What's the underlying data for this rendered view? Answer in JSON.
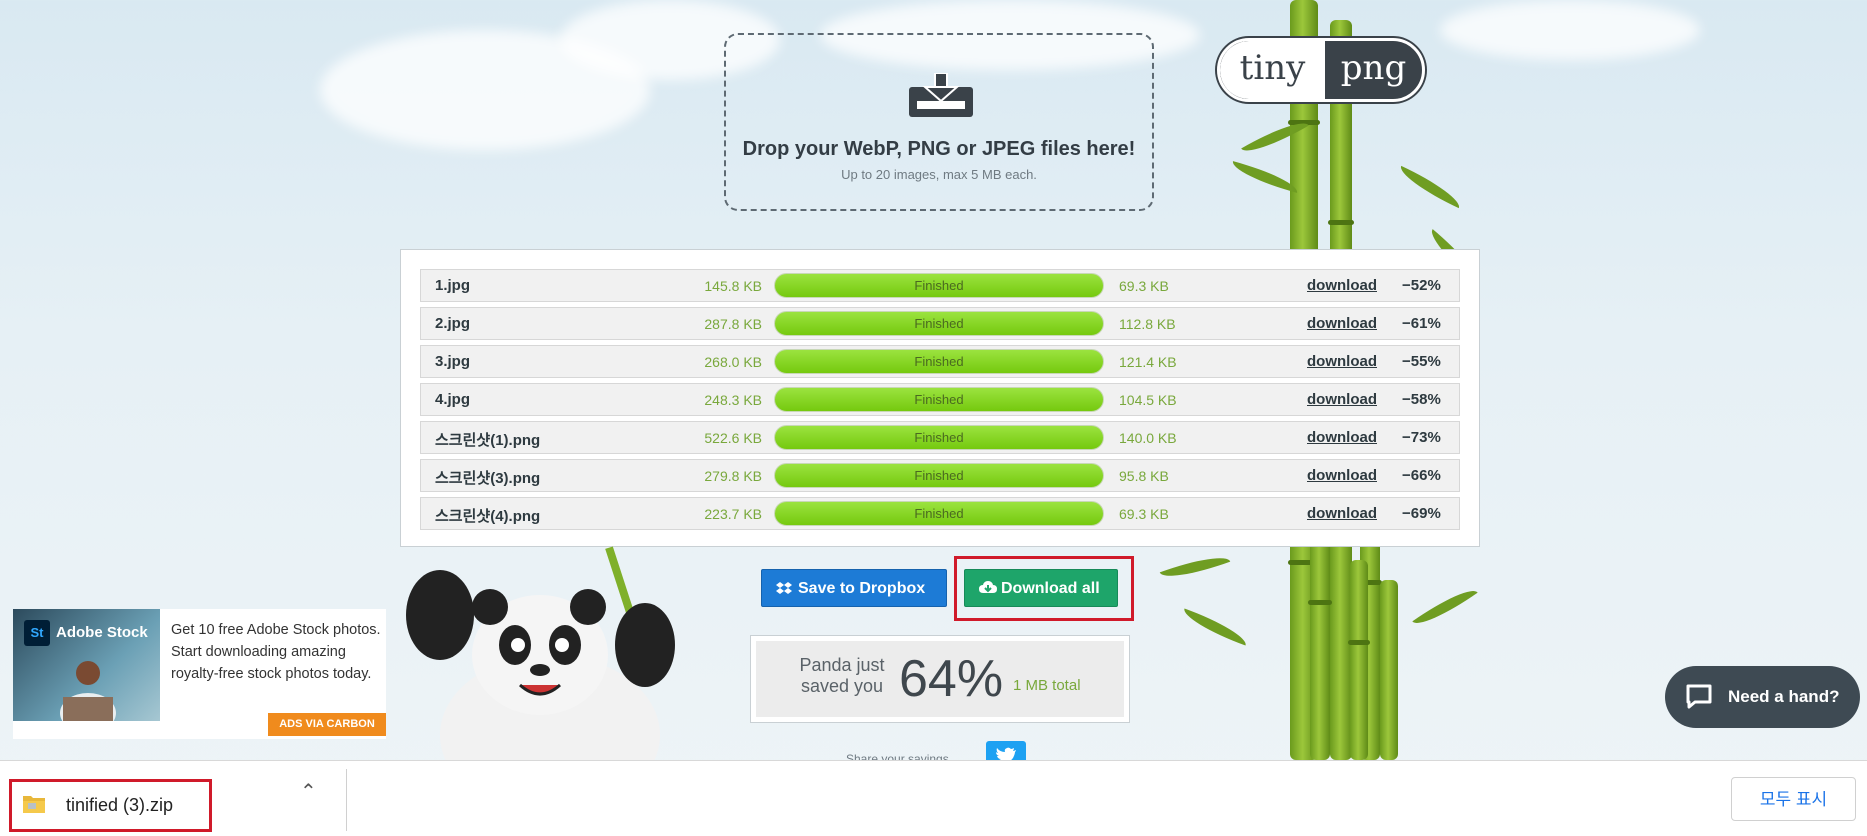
{
  "dropzone": {
    "title": "Drop your WebP, PNG or JPEG files here!",
    "subtitle": "Up to 20 images, max 5 MB each."
  },
  "logo": {
    "left": "tiny",
    "right": "png"
  },
  "files": [
    {
      "name": "1.jpg",
      "original": "145.8 KB",
      "status": "Finished",
      "compressed": "69.3 KB",
      "action": "download",
      "saving": "−52%"
    },
    {
      "name": "2.jpg",
      "original": "287.8 KB",
      "status": "Finished",
      "compressed": "112.8 KB",
      "action": "download",
      "saving": "−61%"
    },
    {
      "name": "3.jpg",
      "original": "268.0 KB",
      "status": "Finished",
      "compressed": "121.4 KB",
      "action": "download",
      "saving": "−55%"
    },
    {
      "name": "4.jpg",
      "original": "248.3 KB",
      "status": "Finished",
      "compressed": "104.5 KB",
      "action": "download",
      "saving": "−58%"
    },
    {
      "name": "스크린샷(1).png",
      "original": "522.6 KB",
      "status": "Finished",
      "compressed": "140.0 KB",
      "action": "download",
      "saving": "−73%"
    },
    {
      "name": "스크린샷(3).png",
      "original": "279.8 KB",
      "status": "Finished",
      "compressed": "95.8 KB",
      "action": "download",
      "saving": "−66%"
    },
    {
      "name": "스크린샷(4).png",
      "original": "223.7 KB",
      "status": "Finished",
      "compressed": "69.3 KB",
      "action": "download",
      "saving": "−69%"
    }
  ],
  "actions": {
    "dropbox": "Save to Dropbox",
    "download_all": "Download all"
  },
  "savings": {
    "label": "Panda just saved you",
    "percent": "64%",
    "total": "1 MB total"
  },
  "share": {
    "label": "Share your savings"
  },
  "ad": {
    "brand": "Adobe Stock",
    "badge": "St",
    "text": "Get 10 free Adobe Stock photos. Start downloading amazing royalty-free stock photos today.",
    "via": "ADS VIA CARBON"
  },
  "chat": {
    "label": "Need a hand?"
  },
  "download_bar": {
    "filename": "tinified (3).zip",
    "show_all": "모두 표시"
  },
  "colors": {
    "accent_green": "#75c90e",
    "dropbox_blue": "#1d7bd6",
    "download_green": "#1ea56a",
    "highlight_red": "#d01a2a"
  }
}
